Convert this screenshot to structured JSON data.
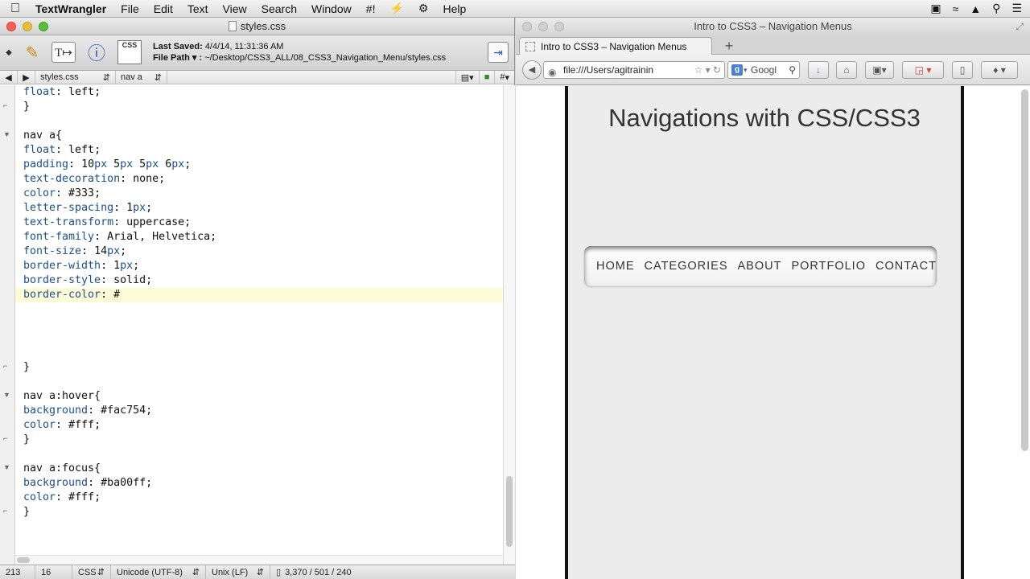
{
  "menubar": {
    "app_name": "TextWrangler",
    "items": [
      "File",
      "Edit",
      "Text",
      "View",
      "Search",
      "Window",
      "#!",
      "⚡",
      "⚙",
      "Help"
    ],
    "status_icons": [
      "camera-icon",
      "wifi-icon",
      "eject-icon",
      "search-icon",
      "list-icon"
    ]
  },
  "editor": {
    "window_title": "styles.css",
    "last_saved_label": "Last Saved:",
    "last_saved_value": "4/4/14, 11:31:36 AM",
    "file_path_label": "File Path ▾ :",
    "file_path_value": "~/Desktop/CSS3_ALL/08_CSS3_Navigation_Menu/styles.css",
    "file_badge": "CSS",
    "navbar": {
      "back": "◀",
      "forward": "▶",
      "file_name": "styles.css",
      "function_name": "nav a",
      "hash": "#"
    },
    "code_lines": [
      {
        "text": "float: left;",
        "kind": "prop"
      },
      {
        "text": "}",
        "kind": "plain"
      },
      {
        "text": "",
        "kind": "plain"
      },
      {
        "text": "nav a{",
        "kind": "plain"
      },
      {
        "text": "float: left;",
        "kind": "prop"
      },
      {
        "text": "padding: 10px 5px 5px 6px;",
        "kind": "prop"
      },
      {
        "text": "text-decoration: none;",
        "kind": "prop"
      },
      {
        "text": "color: #333;",
        "kind": "prop"
      },
      {
        "text": "letter-spacing: 1px;",
        "kind": "prop"
      },
      {
        "text": "text-transform: uppercase;",
        "kind": "prop"
      },
      {
        "text": "font-family: Arial, Helvetica;",
        "kind": "prop"
      },
      {
        "text": "font-size: 14px;",
        "kind": "prop"
      },
      {
        "text": "border-width: 1px;",
        "kind": "prop"
      },
      {
        "text": "border-style: solid;",
        "kind": "prop"
      },
      {
        "text": "border-color: #",
        "kind": "prop",
        "current": true
      },
      {
        "text": "",
        "kind": "plain"
      },
      {
        "text": "",
        "kind": "plain"
      },
      {
        "text": "",
        "kind": "plain"
      },
      {
        "text": "",
        "kind": "plain"
      },
      {
        "text": "}",
        "kind": "plain"
      },
      {
        "text": "",
        "kind": "plain"
      },
      {
        "text": "nav a:hover{",
        "kind": "plain"
      },
      {
        "text": "background: #fac754;",
        "kind": "prop"
      },
      {
        "text": "color: #fff;",
        "kind": "prop"
      },
      {
        "text": "}",
        "kind": "plain"
      },
      {
        "text": "",
        "kind": "plain"
      },
      {
        "text": "nav a:focus{",
        "kind": "plain"
      },
      {
        "text": "background: #ba00ff;",
        "kind": "prop"
      },
      {
        "text": "color: #fff;",
        "kind": "prop"
      },
      {
        "text": "}",
        "kind": "plain"
      }
    ],
    "status": {
      "line": "213",
      "column": "16",
      "language": "CSS",
      "encoding": "Unicode (UTF-8)",
      "line_endings": "Unix (LF)",
      "stats": "3,370 / 501 / 240"
    }
  },
  "browser": {
    "window_title": "Intro to CSS3 – Navigation Menus",
    "tab_title": "Intro to CSS3 – Navigation Menus",
    "new_tab": "+",
    "url": "file:///Users/agitrainin",
    "search_placeholder": "Googl",
    "page": {
      "heading": "Navigations with CSS/CSS3",
      "nav_links": [
        "Home",
        "Categories",
        "About",
        "Portfolio",
        "Contact"
      ]
    }
  },
  "colors": {
    "code_property": "#1d4f86",
    "current_line": "#fefbd8",
    "close": "#fc5b57",
    "minimize": "#e5bf3c",
    "maximize": "#57c038"
  }
}
